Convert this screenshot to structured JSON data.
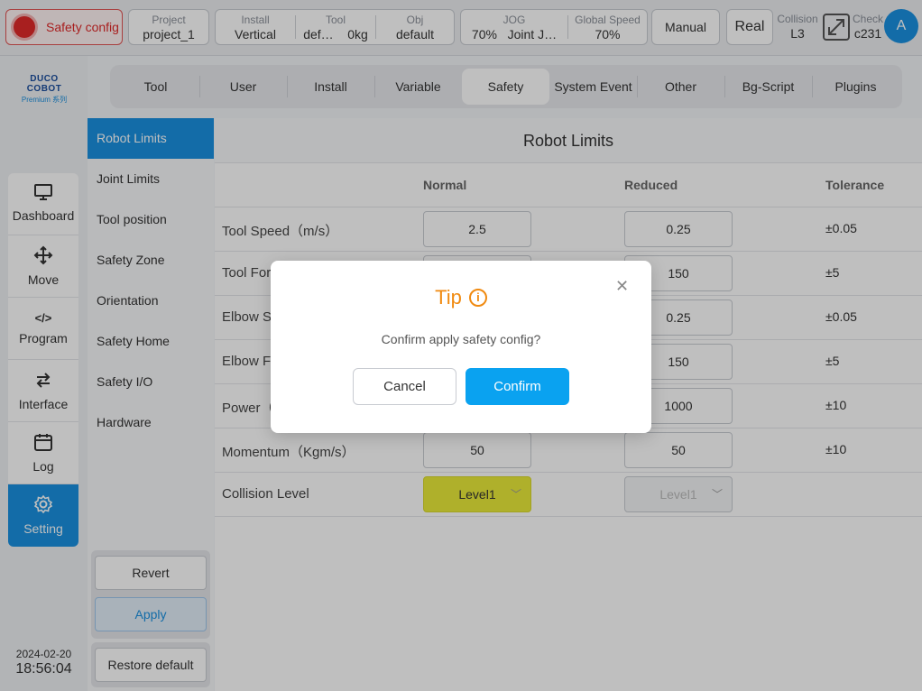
{
  "topbar": {
    "safety_label": "Safety config",
    "project": {
      "label": "Project",
      "value": "project_1"
    },
    "install": {
      "label": "Install",
      "value": "Vertical"
    },
    "tool": {
      "label": "Tool",
      "value_name": "def…",
      "value_weight": "0kg"
    },
    "obj": {
      "label": "Obj",
      "value": "default"
    },
    "jog": {
      "label": "JOG",
      "value_pct": "70%",
      "value_mode": "Joint J…"
    },
    "global_speed": {
      "label": "Global Speed",
      "value": "70%"
    },
    "manual": "Manual",
    "real": "Real",
    "collision": {
      "label": "Collision",
      "value": "L3"
    },
    "check": {
      "label": "Check",
      "value": "c231"
    },
    "avatar": "A"
  },
  "logo": {
    "line1": "DUCO COBOT",
    "line2": "Premium 系列"
  },
  "nav": [
    {
      "label": "Dashboard",
      "icon": "monitor-icon"
    },
    {
      "label": "Move",
      "icon": "move-icon"
    },
    {
      "label": "Program",
      "icon": "code-icon"
    },
    {
      "label": "Interface",
      "icon": "swap-icon"
    },
    {
      "label": "Log",
      "icon": "calendar-icon"
    },
    {
      "label": "Setting",
      "icon": "gear-icon"
    }
  ],
  "clock": {
    "date": "2024-02-20",
    "time": "18:56:04"
  },
  "tabs": [
    "Tool",
    "User",
    "Install",
    "Variable",
    "Safety",
    "System Event",
    "Other",
    "Bg-Script",
    "Plugins"
  ],
  "submenu": [
    "Robot Limits",
    "Joint Limits",
    "Tool position",
    "Safety Zone",
    "Orientation",
    "Safety Home",
    "Safety I/O",
    "Hardware"
  ],
  "side_buttons": {
    "revert": "Revert",
    "apply": "Apply",
    "restore": "Restore default"
  },
  "content": {
    "title": "Robot Limits",
    "headers": {
      "normal": "Normal",
      "reduced": "Reduced",
      "tolerance": "Tolerance"
    },
    "rows": [
      {
        "name": "Tool Speed（m/s）",
        "normal": "2.5",
        "reduced": "0.25",
        "tolerance": "±0.05"
      },
      {
        "name": "Tool For",
        "normal": "",
        "reduced": "150",
        "tolerance": "±5"
      },
      {
        "name": "Elbow S",
        "normal": "",
        "reduced": "0.25",
        "tolerance": "±0.05"
      },
      {
        "name": "Elbow F",
        "normal": "",
        "reduced": "150",
        "tolerance": "±5"
      },
      {
        "name": "Power（",
        "normal": "",
        "reduced": "1000",
        "tolerance": "±10"
      },
      {
        "name": "Momentum（Kgm/s）",
        "normal": "50",
        "reduced": "50",
        "tolerance": "±10"
      }
    ],
    "collision": {
      "name": "Collision Level",
      "normal": "Level1",
      "reduced": "Level1"
    }
  },
  "dialog": {
    "title": "Tip",
    "message": "Confirm apply safety config?",
    "cancel": "Cancel",
    "confirm": "Confirm"
  }
}
